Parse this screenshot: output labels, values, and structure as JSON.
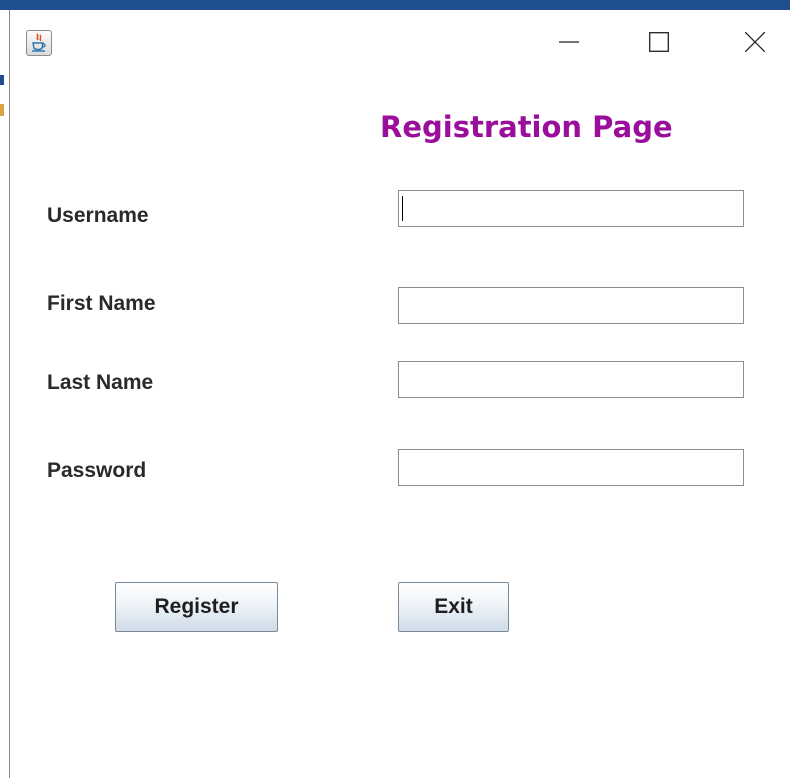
{
  "window": {
    "icon": "java-icon",
    "controls": [
      "minimize-icon",
      "maximize-icon",
      "close-icon"
    ]
  },
  "form": {
    "title": "Registration Page",
    "fields": [
      {
        "label": "Username",
        "value": ""
      },
      {
        "label": "First Name",
        "value": ""
      },
      {
        "label": "Last Name",
        "value": ""
      },
      {
        "label": "Password",
        "value": ""
      }
    ]
  },
  "buttons": {
    "register_label": "Register",
    "exit_label": "Exit"
  },
  "colors": {
    "title": "#9b0e9b",
    "button_border": "#7a8a99"
  }
}
